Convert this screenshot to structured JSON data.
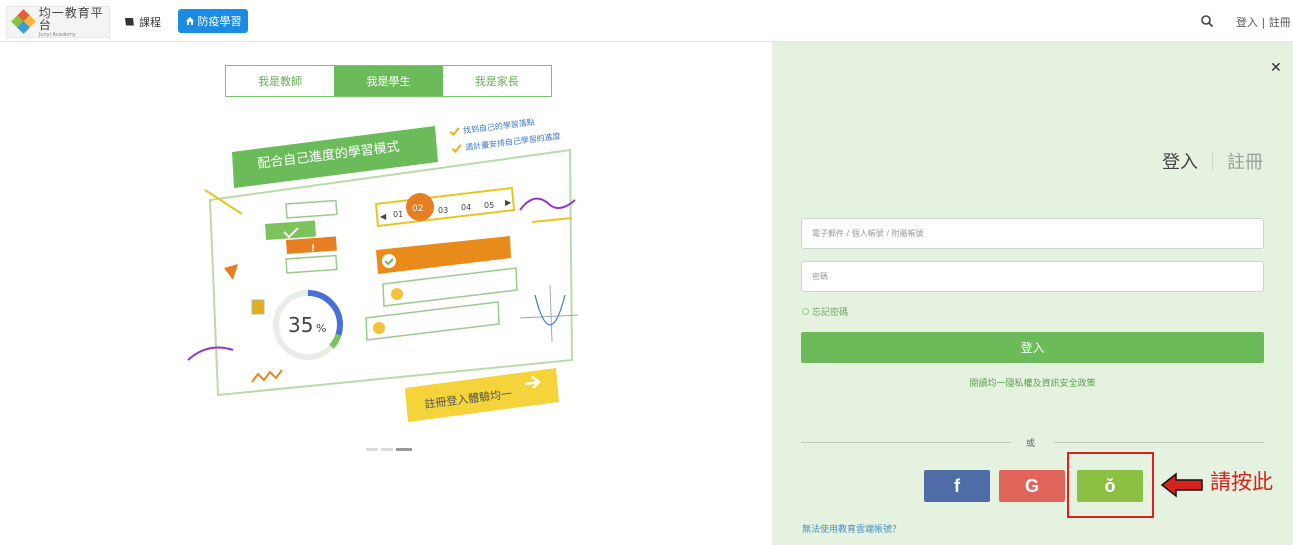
{
  "header": {
    "logo_cn": "均一教育平台",
    "logo_en": "Junyi Academy",
    "nav_course": "課程",
    "nav_pill": "防疫學習",
    "auth_links": "登入 | 註冊"
  },
  "roles": {
    "tabs": [
      {
        "label": "我是教師",
        "active": false
      },
      {
        "label": "我是學生",
        "active": true
      },
      {
        "label": "我是家長",
        "active": false
      }
    ]
  },
  "illustration": {
    "banner": "配合自己進度的學習模式",
    "check1": "找到自己的學習落點",
    "check2": "週計畫安排自己學習的進度",
    "steps": [
      "01",
      "02",
      "03",
      "04",
      "05"
    ],
    "active_step": "02",
    "progress_label": "35",
    "progress_unit": "%",
    "progress_fraction": 0.35,
    "cta": "註冊登入體驗均一"
  },
  "login": {
    "mode_login": "登入",
    "mode_register": "註冊",
    "email_placeholder": "電子郵件 / 個人帳號 / 附屬帳號",
    "password_placeholder": "密碼",
    "forgot": "忘記密碼",
    "login_button": "登入",
    "policy": "閱讀均一隱私權及資訊安全政策",
    "or": "或",
    "facebook": "f",
    "google": "G",
    "edu_cloud": "ǒ",
    "press_here": "請按此",
    "no_account": "無法使用教育雲端帳號？"
  },
  "colors": {
    "accent_green": "#6cbb5a",
    "nav_blue": "#1c8ce2",
    "facebook": "#4e6da6",
    "google": "#e0645a",
    "edu_cloud": "#8cc043",
    "highlight_red": "#e01e1e"
  },
  "icons": {
    "logo": "junyi-logo-icon",
    "course": "book-icon",
    "home": "home-icon",
    "search": "search-icon",
    "close": "close-icon",
    "arrow": "left-arrow-icon"
  }
}
